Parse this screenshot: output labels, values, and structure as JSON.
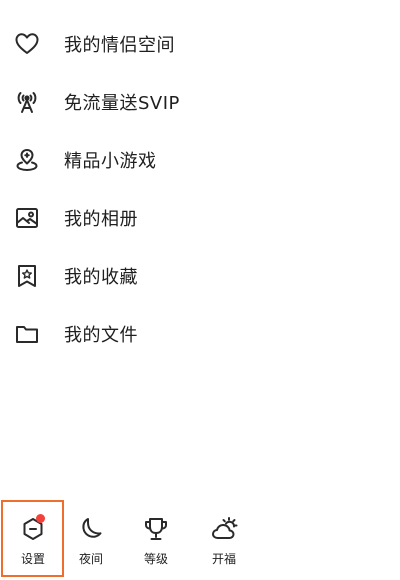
{
  "menu": {
    "items": [
      {
        "label": "我的情侣空间",
        "icon": "heart-icon"
      },
      {
        "label": "免流量送SVIP",
        "icon": "signal-tower-icon"
      },
      {
        "label": "精品小游戏",
        "icon": "game-pin-icon"
      },
      {
        "label": "我的相册",
        "icon": "photo-album-icon"
      },
      {
        "label": "我的收藏",
        "icon": "bookmark-star-icon"
      },
      {
        "label": "我的文件",
        "icon": "folder-icon"
      }
    ]
  },
  "bottom_bar": {
    "items": [
      {
        "label": "设置",
        "icon": "settings-hexagon-icon",
        "has_badge": true,
        "highlighted": true
      },
      {
        "label": "夜间",
        "icon": "moon-icon"
      },
      {
        "label": "等级",
        "icon": "trophy-icon"
      },
      {
        "label": "开福",
        "icon": "sun-cloud-icon"
      }
    ]
  },
  "colors": {
    "text": "#1f1f1f",
    "icon_stroke": "#2a2a2a",
    "badge": "#f0413a",
    "highlight_border": "#ee6f2d",
    "background": "#ffffff"
  }
}
